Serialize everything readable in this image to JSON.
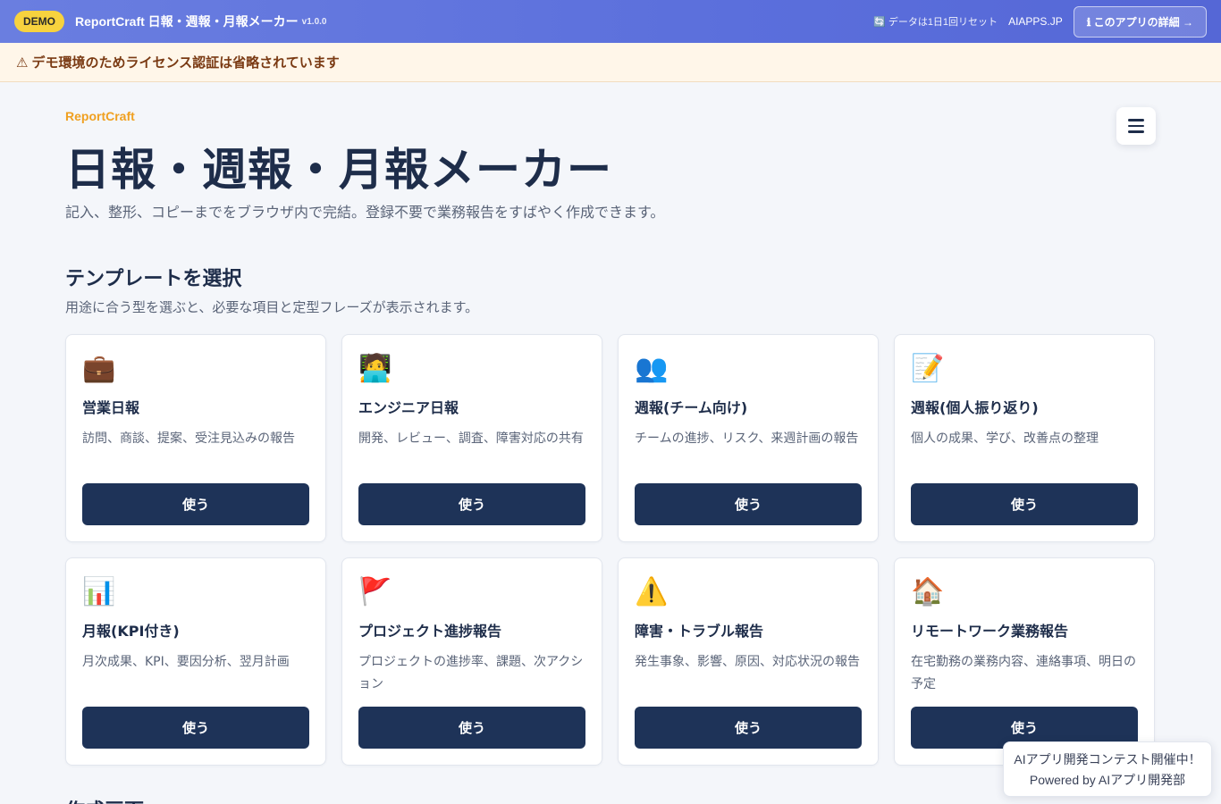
{
  "topbar": {
    "badge": "DEMO",
    "title": "ReportCraft 日報・週報・月報メーカー",
    "version": "v1.0.0",
    "reset_note": "🔄 データは1日1回リセット",
    "site": "AIAPPS.JP",
    "detail_button": "ℹ このアプリの詳細 →"
  },
  "notice": {
    "icon": "⚠",
    "text": "デモ環境のためライセンス認証は省略されています"
  },
  "hero": {
    "brand": "ReportCraft",
    "title": "日報・週報・月報メーカー",
    "subtitle": "記入、整形、コピーまでをブラウザ内で完結。登録不要で業務報告をすばやく作成できます。"
  },
  "templates": {
    "title": "テンプレートを選択",
    "description": "用途に合う型を選ぶと、必要な項目と定型フレーズが表示されます。",
    "use_label": "使う",
    "items": [
      {
        "icon": "💼",
        "title": "営業日報",
        "desc": "訪問、商談、提案、受注見込みの報告"
      },
      {
        "icon": "🧑‍💻",
        "title": "エンジニア日報",
        "desc": "開発、レビュー、調査、障害対応の共有"
      },
      {
        "icon": "👥",
        "title": "週報(チーム向け)",
        "desc": "チームの進捗、リスク、来週計画の報告"
      },
      {
        "icon": "📝",
        "title": "週報(個人振り返り)",
        "desc": "個人の成果、学び、改善点の整理"
      },
      {
        "icon": "📊",
        "title": "月報(KPI付き)",
        "desc": "月次成果、KPI、要因分析、翌月計画"
      },
      {
        "icon": "🚩",
        "title": "プロジェクト進捗報告",
        "desc": "プロジェクトの進捗率、課題、次アクション"
      },
      {
        "icon": "⚠️",
        "title": "障害・トラブル報告",
        "desc": "発生事象、影響、原因、対応状況の報告"
      },
      {
        "icon": "🏠",
        "title": "リモートワーク業務報告",
        "desc": "在宅勤務の業務内容、連絡事項、明日の予定"
      }
    ]
  },
  "next_section": "作成画面",
  "floating": {
    "line1": "AIアプリ開発コンテスト開催中！",
    "line2": "Powered by AIアプリ開発部"
  }
}
